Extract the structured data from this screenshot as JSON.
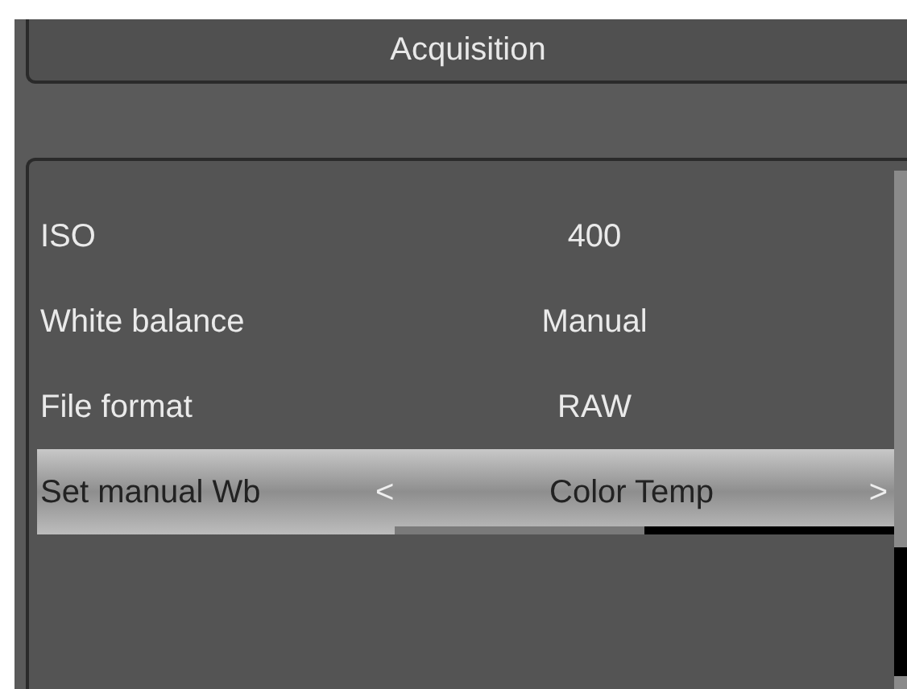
{
  "header": {
    "title": "Acquisition"
  },
  "settings": [
    {
      "kind": "value",
      "label": "ISO",
      "value": "400",
      "selected": false
    },
    {
      "kind": "value",
      "label": "White balance",
      "value": "Manual",
      "selected": false
    },
    {
      "kind": "value",
      "label": "File format",
      "value": "RAW",
      "selected": false
    },
    {
      "kind": "selector",
      "label": "Set manual Wb",
      "value": "Color Temp",
      "prev": "<",
      "next": ">",
      "selected": true,
      "level": 0.5
    }
  ]
}
